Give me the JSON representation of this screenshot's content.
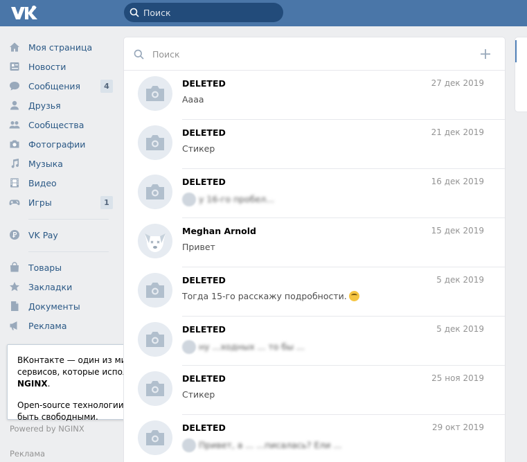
{
  "header": {
    "logo": "vk-logo-icon",
    "search_placeholder": "Поиск"
  },
  "sidebar": {
    "items": [
      {
        "label": "Моя страница",
        "icon": "home-icon"
      },
      {
        "label": "Новости",
        "icon": "news-icon"
      },
      {
        "label": "Сообщения",
        "icon": "messages-icon",
        "count": "4"
      },
      {
        "label": "Друзья",
        "icon": "user-icon"
      },
      {
        "label": "Сообщества",
        "icon": "users-icon"
      },
      {
        "label": "Фотографии",
        "icon": "camera-icon"
      },
      {
        "label": "Музыка",
        "icon": "music-icon"
      },
      {
        "label": "Видео",
        "icon": "video-icon"
      },
      {
        "label": "Игры",
        "icon": "gamepad-icon",
        "count": "1"
      },
      {
        "label": "VK Pay",
        "icon": "vkpay-icon"
      },
      {
        "label": "Товары",
        "icon": "bag-icon"
      },
      {
        "label": "Закладки",
        "icon": "star-icon"
      },
      {
        "label": "Документы",
        "icon": "document-icon"
      },
      {
        "label": "Реклама",
        "icon": "megaphone-icon"
      }
    ],
    "tooltip": {
      "line1_pre": "ВКонтакте — один из миллионов сервисов, которые используют ",
      "line1_bold": "NGINX",
      "line1_post": ".",
      "line2": "Open-source технологии должны быть свободными."
    },
    "powered_by": "Powered by NGINX",
    "ads_link": "Реклама"
  },
  "messages": {
    "search_placeholder": "Поиск",
    "dialogs": [
      {
        "name": "DELETED",
        "date": "27 дек 2019",
        "preview": "Аааа",
        "avatar": "camera"
      },
      {
        "name": "DELETED",
        "date": "21 дек 2019",
        "preview": "Стикер",
        "avatar": "camera"
      },
      {
        "name": "DELETED",
        "date": "16 дек 2019",
        "preview": "у 16-го пробел...",
        "avatar": "camera",
        "blurred": true
      },
      {
        "name": "Meghan Arnold",
        "date": "15 дек 2019",
        "preview": "Привет",
        "avatar": "dog"
      },
      {
        "name": "DELETED",
        "date": "5 дек 2019",
        "preview": "Тогда 15-го расскажу подробности.",
        "avatar": "camera",
        "emoji": true
      },
      {
        "name": "DELETED",
        "date": "5 дек 2019",
        "preview": "ну ...ходных ... то бы ...",
        "avatar": "camera",
        "blurred": true
      },
      {
        "name": "DELETED",
        "date": "25 ноя 2019",
        "preview": "Стикер",
        "avatar": "camera"
      },
      {
        "name": "DELETED",
        "date": "29 окт 2019",
        "preview": "Привет, а ... ...писалась? Ели ...",
        "avatar": "camera",
        "blurred": true
      }
    ]
  },
  "colors": {
    "header": "#4a76a8",
    "link": "#2a5885",
    "background": "#edeef0"
  }
}
